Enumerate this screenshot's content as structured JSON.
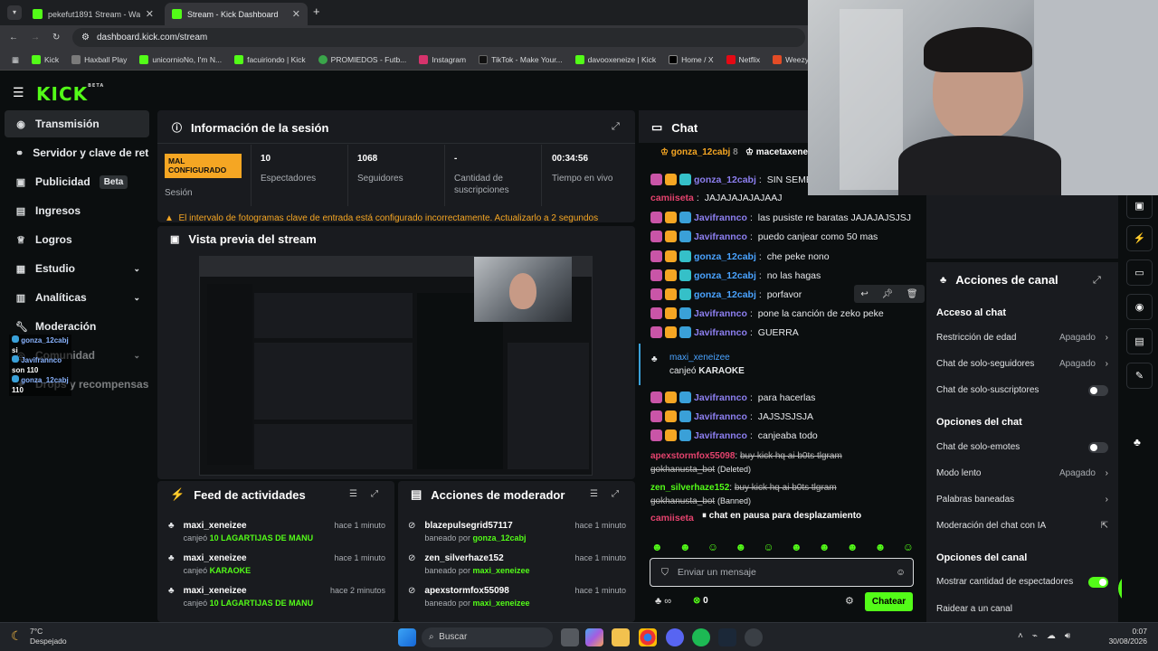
{
  "browser": {
    "tabs": [
      {
        "label": "pekefut1891 Stream - Watch Li"
      },
      {
        "label": "Stream - Kick Dashboard"
      }
    ],
    "url": "dashboard.kick.com/stream",
    "bookmarks": [
      "Kick",
      "Haxball Play",
      "unicornioNo, I'm N...",
      "facuiriondo | Kick",
      "PROMIEDOS - Futb...",
      "Instagram",
      "TikTok - Make Your...",
      "davooxeneize | Kick",
      "Home / X",
      "Netflix",
      "Weezyx | Manda tu..."
    ]
  },
  "header": {
    "logo": "KICK",
    "logo_sup": "BETA"
  },
  "sidebar": {
    "items": [
      {
        "label": "Transmisión",
        "icon": "broadcast-icon"
      },
      {
        "label": "Servidor y clave de retransmisión",
        "icon": "link-icon"
      },
      {
        "label": "Publicidad",
        "badge": "Beta",
        "icon": "ad-icon"
      },
      {
        "label": "Ingresos",
        "icon": "money-icon"
      },
      {
        "label": "Logros",
        "icon": "trophy-icon"
      },
      {
        "label": "Estudio",
        "icon": "studio-icon"
      },
      {
        "label": "Analíticas",
        "icon": "chart-icon"
      },
      {
        "label": "Moderación",
        "icon": "wrench-icon"
      },
      {
        "label": "Comunidad",
        "icon": "community-icon"
      },
      {
        "label": "Drops y recompensas",
        "icon": "gift-icon"
      }
    ],
    "overlay": [
      "gonza_12cabj",
      "si",
      "Javifrannco",
      "son 110",
      "gonza_12cabj",
      "110"
    ]
  },
  "session": {
    "title": "Información de la sesión",
    "status_badge": "MAL CONFIGURADO",
    "status_label": "Sesión",
    "stats": [
      {
        "value": "10",
        "label": "Espectadores"
      },
      {
        "value": "1068",
        "label": "Seguidores"
      },
      {
        "value": "-",
        "label": "Cantidad de suscripciones"
      },
      {
        "value": "00:34:56",
        "label": "Tiempo en vivo"
      }
    ],
    "warning": "El intervalo de fotogramas clave de entrada está configurado incorrectamente. Actualizarlo a 2 segundos"
  },
  "preview": {
    "title": "Vista previa del stream"
  },
  "feed": {
    "title": "Feed de actividades",
    "items": [
      {
        "user": "maxi_xeneizee",
        "action": "canjeó",
        "item": "10 LAGARTIJAS DE MANU",
        "time": "hace 1 minuto"
      },
      {
        "user": "maxi_xeneizee",
        "action": "canjeó",
        "item": "KARAOKE",
        "time": "hace 1 minuto"
      },
      {
        "user": "maxi_xeneizee",
        "action": "canjeó",
        "item": "10 LAGARTIJAS DE MANU",
        "time": "hace 2 minutos"
      }
    ]
  },
  "mod": {
    "title": "Acciones de moderador",
    "items": [
      {
        "user": "blazepulsegrid57117",
        "action": "baneado por",
        "by": "gonza_12cabj",
        "time": "hace 1 minuto"
      },
      {
        "user": "zen_silverhaze152",
        "action": "baneado por",
        "by": "maxi_xeneizee",
        "time": "hace 1 minuto"
      },
      {
        "user": "apexstormfox55098",
        "action": "baneado por",
        "by": "maxi_xeneizee",
        "time": "hace 1 minuto"
      }
    ]
  },
  "chat": {
    "title": "Chat",
    "pinned": [
      {
        "user": "gonza_12cabj",
        "count": "8"
      },
      {
        "user": "macetaxene"
      }
    ],
    "messages": [
      {
        "user": "gonza_12cabj",
        "text": "SIN SEMEN",
        "ucls": "u1"
      },
      {
        "user": "camiiseta",
        "text": "JAJAJAJAJAJAAJ",
        "ucls": "u3",
        "nobadge": true
      },
      {
        "user": "Javifrannco",
        "text": "las pusiste re baratas JAJAJAJSJSJ",
        "ucls": "u2"
      },
      {
        "user": "Javifrannco",
        "text": "puedo canjear como 50 mas",
        "ucls": "u2"
      },
      {
        "user": "gonza_12cabj",
        "text": "che peke nono",
        "ucls": "u1"
      },
      {
        "user": "gonza_12cabj",
        "text": "no las hagas",
        "ucls": "u1"
      },
      {
        "user": "gonza_12cabj",
        "text": "porfavor",
        "ucls": "u1"
      },
      {
        "user": "Javifrannco",
        "text": "pone la canción de zeko peke",
        "ucls": "u2"
      },
      {
        "user": "Javifrannco",
        "text": "GUERRA",
        "ucls": "u2"
      }
    ],
    "redeem": {
      "user": "maxi_xeneizee",
      "action": "canjeó",
      "item": "KARAOKE"
    },
    "messages2": [
      {
        "user": "Javifrannco",
        "text": "para hacerlas"
      },
      {
        "user": "Javifrannco",
        "text": "JAJSJSJSJA"
      },
      {
        "user": "Javifrannco",
        "text": "canjeaba todo"
      }
    ],
    "deleted": [
      {
        "user": "apexstormfox55098",
        "text": "buy kick hq ai b0ts tlgram gokhanusta_bot",
        "tag": "(Deleted)"
      },
      {
        "user": "zen_silverhaze152",
        "text": "buy kick hq ai b0ts tlgram gokhanusta_bot",
        "tag": "(Banned)"
      }
    ],
    "last_user": "camiiseta",
    "paused": "chat en pausa para desplazamiento",
    "input_placeholder": "Enviar un mensaje",
    "points": "0",
    "send_label": "Chatear"
  },
  "actions": {
    "title": "Acciones de canal",
    "sections": {
      "access": "Acceso al chat",
      "chat_options": "Opciones del chat",
      "channel_options": "Opciones del canal"
    },
    "age": {
      "label": "Restricción de edad",
      "value": "Apagado"
    },
    "followers": {
      "label": "Chat de solo-seguidores",
      "value": "Apagado"
    },
    "subs": {
      "label": "Chat de solo-suscriptores"
    },
    "emotes": {
      "label": "Chat de solo-emotes"
    },
    "slow": {
      "label": "Modo lento",
      "value": "Apagado"
    },
    "banned": {
      "label": "Palabras baneadas"
    },
    "ai": {
      "label": "Moderación del chat con IA"
    },
    "viewers": {
      "label": "Mostrar cantidad de espectadores"
    },
    "raid": {
      "label": "Raidear a un canal"
    }
  },
  "taskbar": {
    "temp": "7°C",
    "weather": "Despejado",
    "search": "Buscar",
    "time": "0:07",
    "date": "30/08/2026"
  }
}
